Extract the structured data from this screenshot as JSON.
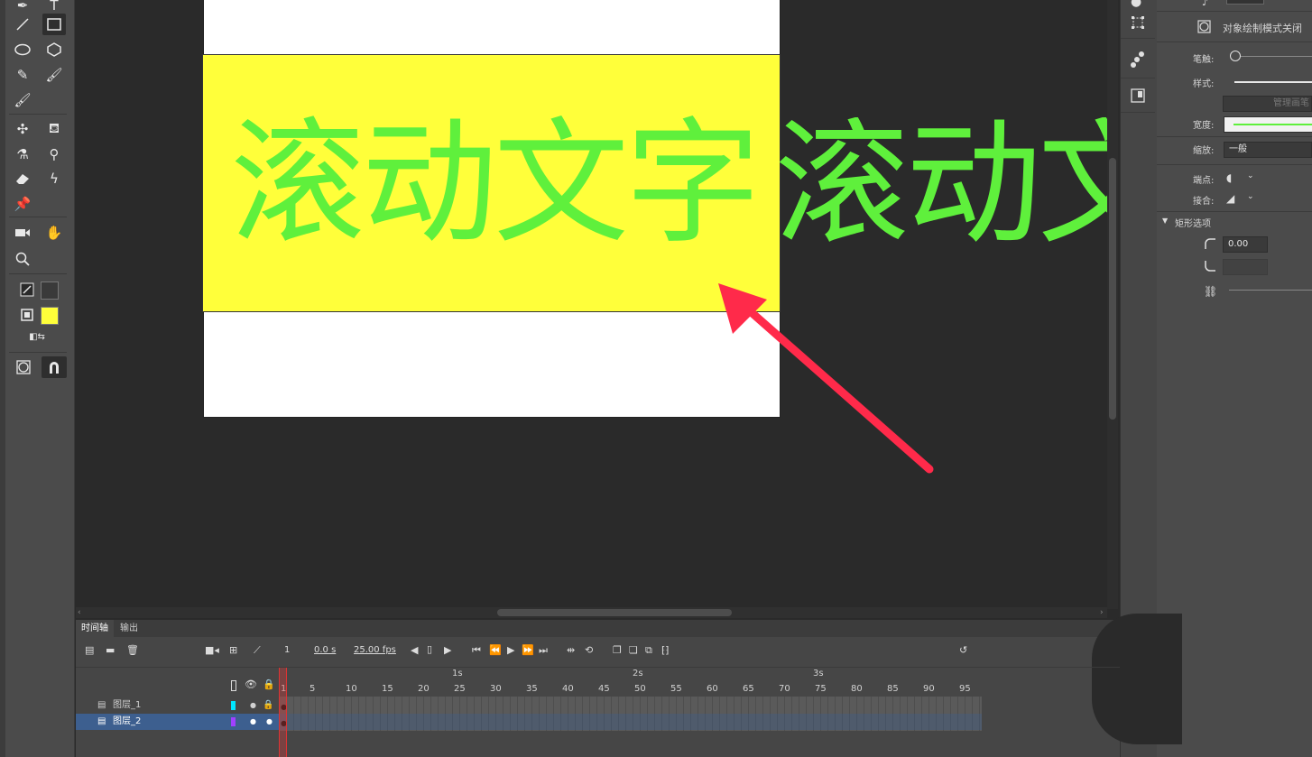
{
  "canvas": {
    "scroll_text": "滚动文字",
    "scroll_text_overflow": "滚动文",
    "text_color": "#5ff03c",
    "rect_fill": "#ffff3a"
  },
  "annotation": {
    "arrow_color": "#ff2a4a"
  },
  "toolbar": {
    "icons": [
      "pen-icon",
      "text-icon",
      "line-icon",
      "rectangle-icon",
      "oval-icon",
      "polygon-icon",
      "pencil-icon",
      "paintbrush-icon",
      "brush-icon",
      "bone-icon",
      "paint-bucket-icon",
      "ink-bottle-icon",
      "eyedropper-icon",
      "eraser-icon",
      "width-icon",
      "pin-icon",
      "camera-icon",
      "hand-icon",
      "zoom-icon",
      "stroke-color-icon",
      "fill-color-icon",
      "swap-colors-icon",
      "object-drawing-icon",
      "snap-icon"
    ],
    "stroke_color": "#3a3a3a",
    "fill_color": "#ffff3a"
  },
  "properties": {
    "object_draw": "对象绘制模式关闭",
    "stroke_label": "笔触:",
    "style_label": "样式:",
    "manage_brush": "管理画笔",
    "width_label": "宽度:",
    "scale_label": "缩放:",
    "scale_value": "一般",
    "cap_label": "端点:",
    "join_label": "接合:",
    "rect_options": "矩形选项",
    "corner_value": "0.00"
  },
  "timeline": {
    "tabs": [
      "时间轴",
      "输出"
    ],
    "frame": "1",
    "time": "0.0 s",
    "fps": "25.00 fps",
    "seconds": [
      "1s",
      "2s",
      "3s"
    ],
    "ticks": [
      "1",
      "5",
      "10",
      "15",
      "20",
      "25",
      "30",
      "35",
      "40",
      "45",
      "50",
      "55",
      "60",
      "65",
      "70",
      "75",
      "80",
      "85",
      "90",
      "95"
    ],
    "layers": [
      {
        "name": "图层_1",
        "color": "#00e5ff",
        "locked": true,
        "selected": false
      },
      {
        "name": "图层_2",
        "color": "#a040ff",
        "locked": false,
        "selected": true
      }
    ]
  }
}
